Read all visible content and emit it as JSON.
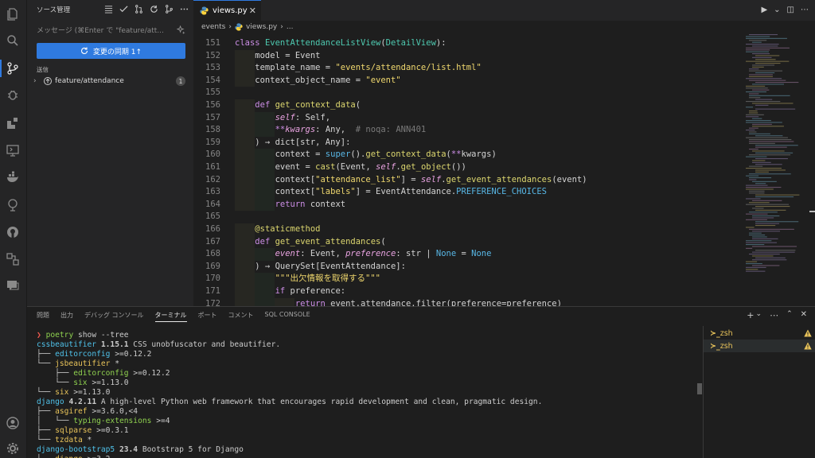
{
  "sidebar": {
    "title": "ソース管理",
    "commit_placeholder": "メッセージ (⌘Enter で \"feature/att...",
    "sync_button": "変更の同期 1↑",
    "section": "送信",
    "branch": "feature/attendance",
    "branch_badge": "1"
  },
  "editor": {
    "tab_label": "views.py",
    "close_glyph": "✕",
    "breadcrumb": [
      "events",
      "›",
      "views.py",
      "›",
      "..."
    ],
    "lines": [
      {
        "n": "151",
        "html": "<span class=\"kw\">class</span> <span class=\"cls\">EventAttendanceListView</span>(<span class=\"cls\">DetailView</span>):"
      },
      {
        "n": "152",
        "html": "    model = Event"
      },
      {
        "n": "153",
        "html": "    template_name = <span class=\"str\">\"events/attendance/list.html\"</span>"
      },
      {
        "n": "154",
        "html": "    context_object_name = <span class=\"str\">\"event\"</span>"
      },
      {
        "n": "155",
        "html": ""
      },
      {
        "n": "156",
        "html": "    <span class=\"kw\">def</span> <span class=\"fn\">get_context_data</span>("
      },
      {
        "n": "157",
        "html": "        <span class=\"param\">self</span>: Self,"
      },
      {
        "n": "158",
        "html": "        <span class=\"kw\">**</span><span class=\"param\">kwargs</span>: Any,  <span class=\"cm\"># noqa: ANN401</span>"
      },
      {
        "n": "159",
        "html": "    ) → dict[str, Any]:"
      },
      {
        "n": "160",
        "html": "        context = <span class=\"blt\">super</span>().<span class=\"fn\">get_context_data</span>(<span class=\"kw\">**</span>kwargs)"
      },
      {
        "n": "161",
        "html": "        event = <span class=\"fn\">cast</span>(Event, <span class=\"param\">self</span>.<span class=\"fn\">get_object</span>())"
      },
      {
        "n": "162",
        "html": "        context[<span class=\"str\">\"attendance_list\"</span>] = <span class=\"param\">self</span>.<span class=\"fn\">get_event_attendances</span>(event)"
      },
      {
        "n": "163",
        "html": "        context[<span class=\"str\">\"labels\"</span>] = EventAttendance.<span class=\"blt\">PREFERENCE_CHOICES</span>"
      },
      {
        "n": "164",
        "html": "        <span class=\"kw\">return</span> context"
      },
      {
        "n": "165",
        "html": ""
      },
      {
        "n": "166",
        "html": "    <span class=\"fn\">@staticmethod</span>"
      },
      {
        "n": "167",
        "html": "    <span class=\"kw\">def</span> <span class=\"fn\">get_event_attendances</span>("
      },
      {
        "n": "168",
        "html": "        <span class=\"param\">event</span>: Event, <span class=\"param\">preference</span>: str | <span class=\"blt\">None</span> = <span class=\"blt\">None</span>"
      },
      {
        "n": "169",
        "html": "    ) → QuerySet[EventAttendance]:"
      },
      {
        "n": "170",
        "html": "        <span class=\"str\">\"\"\"出欠情報を取得する\"\"\"</span>"
      },
      {
        "n": "171",
        "html": "        <span class=\"kw\">if</span> preference:"
      },
      {
        "n": "172",
        "html": "            <span class=\"kw\">return</span> event.attendance.filter(preference=preference)"
      }
    ]
  },
  "panel": {
    "tabs": [
      "問題",
      "出力",
      "デバッグ コンソール",
      "ターミナル",
      "ポート",
      "コメント",
      "SQL CONSOLE"
    ],
    "active_tab": "ターミナル",
    "terminal_lines": [
      "<span class=\"tprompt\">❯</span> <span class=\"tg\">poetry</span> show --tree",
      "<span class=\"tc\">cssbeautifier</span> <b>1.15.1</b> CSS unobfuscator and beautifier.",
      "├── <span class=\"tc\">editorconfig</span> &gt;=0.12.2",
      "└── <span class=\"ty\">jsbeautifier</span> *",
      "    ├── <span class=\"tg\">editorconfig</span> &gt;=0.12.2",
      "    └── <span class=\"tg\">six</span> &gt;=1.13.0",
      "└── <span class=\"ty\">six</span> &gt;=1.13.0",
      "<span class=\"tc\">django</span> <b>4.2.11</b> A high-level Python web framework that encourages rapid development and clean, pragmatic design.",
      "├── <span class=\"ty\">asgiref</span> &gt;=3.6.0,&lt;4",
      "│   └── <span class=\"tg\">typing-extensions</span> &gt;=4",
      "├── <span class=\"ty\">sqlparse</span> &gt;=0.3.1",
      "└── <span class=\"ty\">tzdata</span> *",
      "<span class=\"tc\">django-bootstrap5</span> <b>23.4</b> Bootstrap 5 for Django",
      "└── <span class=\"ty\">django</span> &gt;=3.2"
    ],
    "shells": [
      "zsh",
      "zsh"
    ]
  },
  "colors": {
    "accent": "#2f7adf",
    "editor_bg": "#1e1e1e",
    "sidebar_bg": "#252526",
    "warning": "#e8c35a"
  },
  "icons": [
    "files-icon",
    "search-icon",
    "source-control-icon",
    "debug-icon",
    "extensions-icon",
    "remote-explorer-icon",
    "docker-icon",
    "gitlens-icon",
    "github-icon",
    "accounts-icon",
    "settings-icon"
  ]
}
